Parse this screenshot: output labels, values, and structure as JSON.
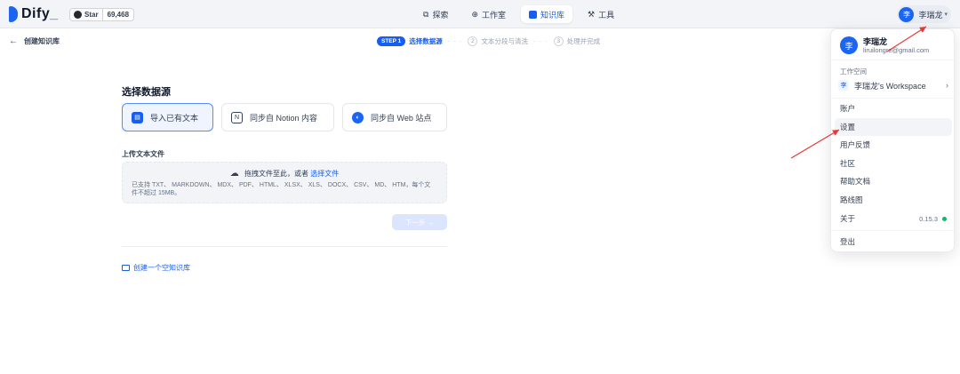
{
  "brand": {
    "name": "Dify",
    "accent": "#1c64f2"
  },
  "github": {
    "star_label": "Star",
    "count": "69,468"
  },
  "nav": [
    {
      "label": "探索",
      "icon": "compass-icon"
    },
    {
      "label": "工作室",
      "icon": "robot-icon"
    },
    {
      "label": "知识库",
      "icon": "book-icon",
      "active": true
    },
    {
      "label": "工具",
      "icon": "hammer-icon"
    }
  ],
  "user": {
    "initial": "李",
    "name": "李瑞龙",
    "email": "liruilongre@gmail.com"
  },
  "subheader": {
    "back_label": "创建知识库",
    "steps": [
      {
        "badge": "STEP 1",
        "label": "选择数据源"
      },
      {
        "badge": "2",
        "label": "文本分段与清洗"
      },
      {
        "badge": "3",
        "label": "处理并完成"
      }
    ]
  },
  "main": {
    "title": "选择数据源",
    "sources": [
      {
        "label": "导入已有文本",
        "icon": "file-icon",
        "selected": true
      },
      {
        "label": "同步自 Notion 内容",
        "icon": "notion-icon"
      },
      {
        "label": "同步自 Web 站点",
        "icon": "globe-icon"
      }
    ],
    "upload_label": "上传文本文件",
    "dropzone": {
      "prompt": "拖拽文件至此，或者",
      "link": "选择文件",
      "hint": "已支持 TXT、 MARKDOWN、 MDX、 PDF、 HTML、 XLSX、 XLS、 DOCX、 CSV、 MD、 HTM，每个文件不超过 15MB。"
    },
    "next_label": "下一步 →",
    "create_empty": "创建一个空知识库"
  },
  "menu": {
    "workspace_label": "工作空间",
    "workspace_initial": "李",
    "workspace_name": "李瑞龙's Workspace",
    "items": [
      "账户",
      "设置",
      "用户反馈",
      "社区",
      "帮助文档",
      "路线图"
    ],
    "about_label": "关于",
    "version": "0.15.3",
    "logout_label": "登出"
  },
  "colors": {
    "annotation_arrow": "#e53935",
    "status_ok": "#12b76a"
  }
}
